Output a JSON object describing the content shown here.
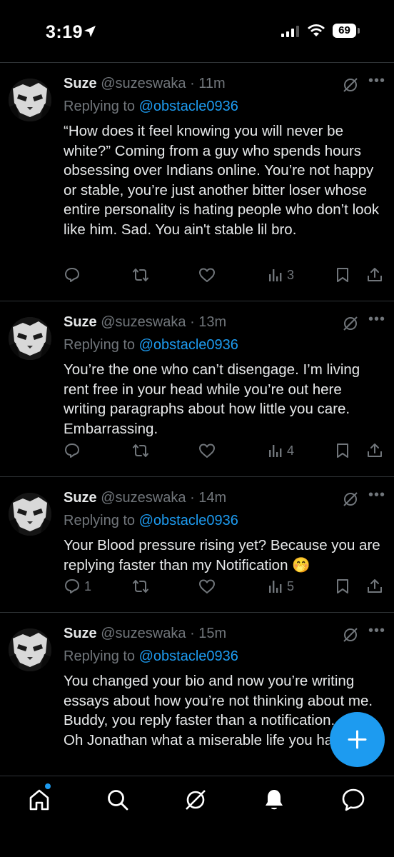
{
  "status_bar": {
    "time": "3:19",
    "battery": "69",
    "icons": [
      "location-arrow-icon",
      "signal-icon",
      "wifi-icon",
      "battery-icon"
    ]
  },
  "tweets": [
    {
      "name": "Suze",
      "handle": "@suzeswaka",
      "time": "· 11m",
      "replying_prefix": "Replying to ",
      "replying_to": "@obstacle0936",
      "text": "“How does it feel knowing you will never be white?” Coming from a guy who spends hours obsessing over Indians online. You’re not happy or stable, you’re just another bitter loser whose entire personality is hating people who don’t look like him. Sad. You ain't stable lil bro.",
      "replies": "",
      "reposts": "",
      "likes": "",
      "views": "3"
    },
    {
      "name": "Suze",
      "handle": "@suzeswaka",
      "time": "· 13m",
      "replying_prefix": "Replying to ",
      "replying_to": "@obstacle0936",
      "text": "You’re the one who can’t disengage. I’m living rent free in your head while you’re out here writing paragraphs about how little you care. Embarrassing.",
      "replies": "",
      "reposts": "",
      "likes": "",
      "views": "4"
    },
    {
      "name": "Suze",
      "handle": "@suzeswaka",
      "time": "· 14m",
      "replying_prefix": "Replying to ",
      "replying_to": "@obstacle0936",
      "text": "Your Blood pressure rising yet? Because you are replying faster than my Notification 🤭",
      "replies": "1",
      "reposts": "",
      "likes": "",
      "views": "5"
    },
    {
      "name": "Suze",
      "handle": "@suzeswaka",
      "time": "· 15m",
      "replying_prefix": "Replying to ",
      "replying_to": "@obstacle0936",
      "text": "You changed your bio and now you’re writing essays about how you’re not thinking about me. Buddy, you reply faster than a notification.\nOh Jonathan what a miserable life you ha",
      "replies": "",
      "reposts": "",
      "likes": "",
      "views": ""
    }
  ],
  "nav": {
    "items": [
      "home-icon",
      "search-icon",
      "grok-icon",
      "notifications-icon",
      "messages-icon"
    ]
  },
  "colors": {
    "background": "#000000",
    "text": "#e7e9ea",
    "muted": "#71767b",
    "accent": "#1d9bf0",
    "divider": "#2f3336"
  }
}
